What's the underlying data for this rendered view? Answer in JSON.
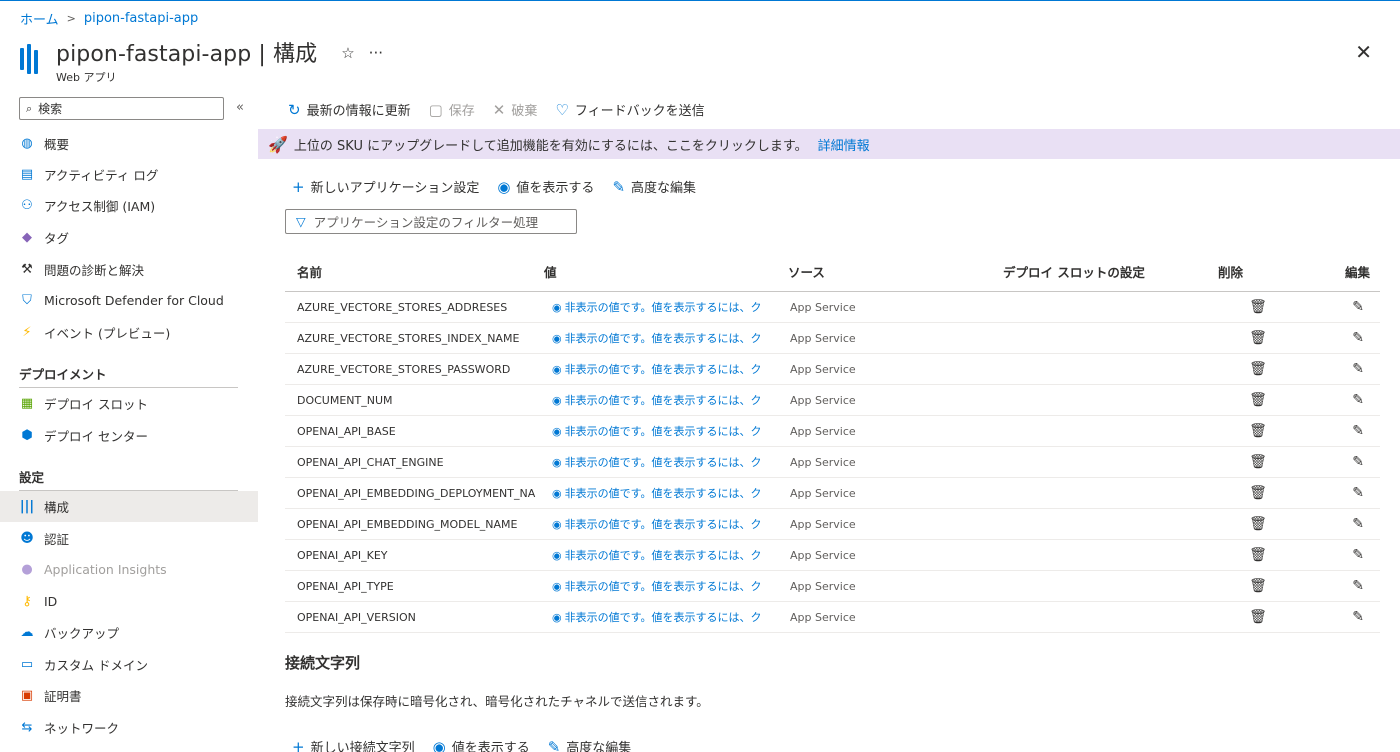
{
  "breadcrumb": {
    "home": "ホーム",
    "current": "pipon-fastapi-app"
  },
  "header": {
    "title": "pipon-fastapi-app | 構成",
    "subtitle": "Web アプリ",
    "star": "☆",
    "more": "···",
    "close": "✕"
  },
  "sidebar": {
    "search_placeholder": "検索",
    "collapse": "«",
    "items_top": [
      {
        "label": "概要",
        "icon": "globe-icon"
      },
      {
        "label": "アクティビティ ログ",
        "icon": "log-icon"
      },
      {
        "label": "アクセス制御 (IAM)",
        "icon": "people-icon"
      },
      {
        "label": "タグ",
        "icon": "tag-icon"
      },
      {
        "label": "問題の診断と解決",
        "icon": "wrench-icon"
      },
      {
        "label": "Microsoft Defender for Cloud",
        "icon": "shield-icon"
      },
      {
        "label": "イベント (プレビュー)",
        "icon": "lightning-icon"
      }
    ],
    "section_deploy": "デプロイメント",
    "items_deploy": [
      {
        "label": "デプロイ スロット",
        "icon": "slots-icon"
      },
      {
        "label": "デプロイ センター",
        "icon": "cube-icon"
      }
    ],
    "section_settings": "設定",
    "items_settings": [
      {
        "label": "構成",
        "icon": "config-icon"
      },
      {
        "label": "認証",
        "icon": "auth-icon"
      },
      {
        "label": "Application Insights",
        "icon": "insights-icon"
      },
      {
        "label": "ID",
        "icon": "key-icon"
      },
      {
        "label": "バックアップ",
        "icon": "backup-icon"
      },
      {
        "label": "カスタム ドメイン",
        "icon": "domain-icon"
      },
      {
        "label": "証明書",
        "icon": "certificate-icon"
      },
      {
        "label": "ネットワーク",
        "icon": "network-icon"
      }
    ]
  },
  "toolbar": {
    "refresh": "最新の情報に更新",
    "save": "保存",
    "discard": "破棄",
    "feedback": "フィードバックを送信"
  },
  "banner": {
    "text": "上位の SKU にアップグレードして追加機能を有効にするには、ここをクリックします。",
    "link": "詳細情報"
  },
  "appsettings": {
    "new": "新しいアプリケーション設定",
    "show_values": "値を表示する",
    "advanced_edit": "高度な編集",
    "filter_placeholder": "アプリケーション設定のフィルター処理",
    "columns": {
      "name": "名前",
      "value": "値",
      "source": "ソース",
      "slot": "デプロイ スロットの設定",
      "delete": "削除",
      "edit": "編集"
    },
    "hidden_value": "非表示の値です。値を表示するには、ク",
    "rows": [
      {
        "name": "AZURE_VECTORE_STORES_ADDRESES",
        "source": "App Service"
      },
      {
        "name": "AZURE_VECTORE_STORES_INDEX_NAME",
        "source": "App Service"
      },
      {
        "name": "AZURE_VECTORE_STORES_PASSWORD",
        "source": "App Service"
      },
      {
        "name": "DOCUMENT_NUM",
        "source": "App Service"
      },
      {
        "name": "OPENAI_API_BASE",
        "source": "App Service"
      },
      {
        "name": "OPENAI_API_CHAT_ENGINE",
        "source": "App Service"
      },
      {
        "name": "OPENAI_API_EMBEDDING_DEPLOYMENT_NA",
        "source": "App Service"
      },
      {
        "name": "OPENAI_API_EMBEDDING_MODEL_NAME",
        "source": "App Service"
      },
      {
        "name": "OPENAI_API_KEY",
        "source": "App Service"
      },
      {
        "name": "OPENAI_API_TYPE",
        "source": "App Service"
      },
      {
        "name": "OPENAI_API_VERSION",
        "source": "App Service"
      }
    ]
  },
  "connstrings": {
    "title": "接続文字列",
    "desc": "接続文字列は保存時に暗号化され、暗号化されたチャネルで送信されます。",
    "new": "新しい接続文字列",
    "show_values": "値を表示する",
    "advanced_edit": "高度な編集"
  },
  "colors": {
    "accent": "#0078d4",
    "banner_bg": "#e9e0f4",
    "active_bg": "#edebe9"
  }
}
